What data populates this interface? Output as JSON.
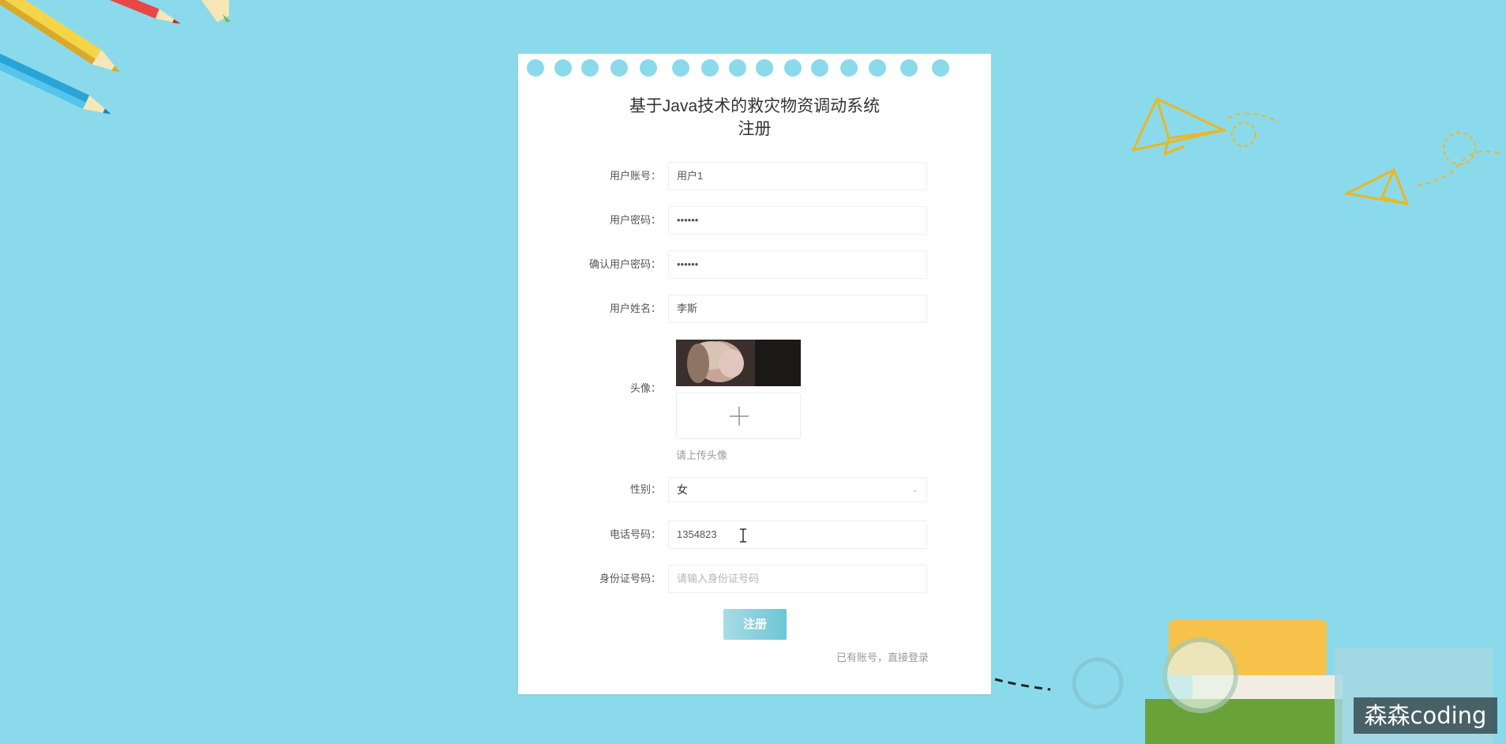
{
  "app": {
    "title_line1": "基于Java技术的救灾物资调动系统",
    "title_line2": "注册"
  },
  "form": {
    "account": {
      "label": "用户账号：",
      "value": "用户1"
    },
    "password": {
      "label": "用户密码：",
      "value": "••••••"
    },
    "confirm_password": {
      "label": "确认用户密码：",
      "value": "••••••"
    },
    "name": {
      "label": "用户姓名：",
      "value": "李斯"
    },
    "avatar": {
      "label": "头像：",
      "hint": "请上传头像",
      "upload_icon": "plus-icon"
    },
    "gender": {
      "label": "性别：",
      "value": "女",
      "icon": "chevron-down-icon"
    },
    "phone": {
      "label": "电话号码：",
      "value": "1354823"
    },
    "id_card": {
      "label": "身份证号码：",
      "placeholder": "请输入身份证号码"
    }
  },
  "actions": {
    "register": "注册",
    "login_link": "已有账号，直接登录"
  },
  "watermark": "森森coding",
  "colors": {
    "background": "#8bdaeb",
    "button_start": "#a7dce6",
    "button_end": "#6fc5d5"
  }
}
